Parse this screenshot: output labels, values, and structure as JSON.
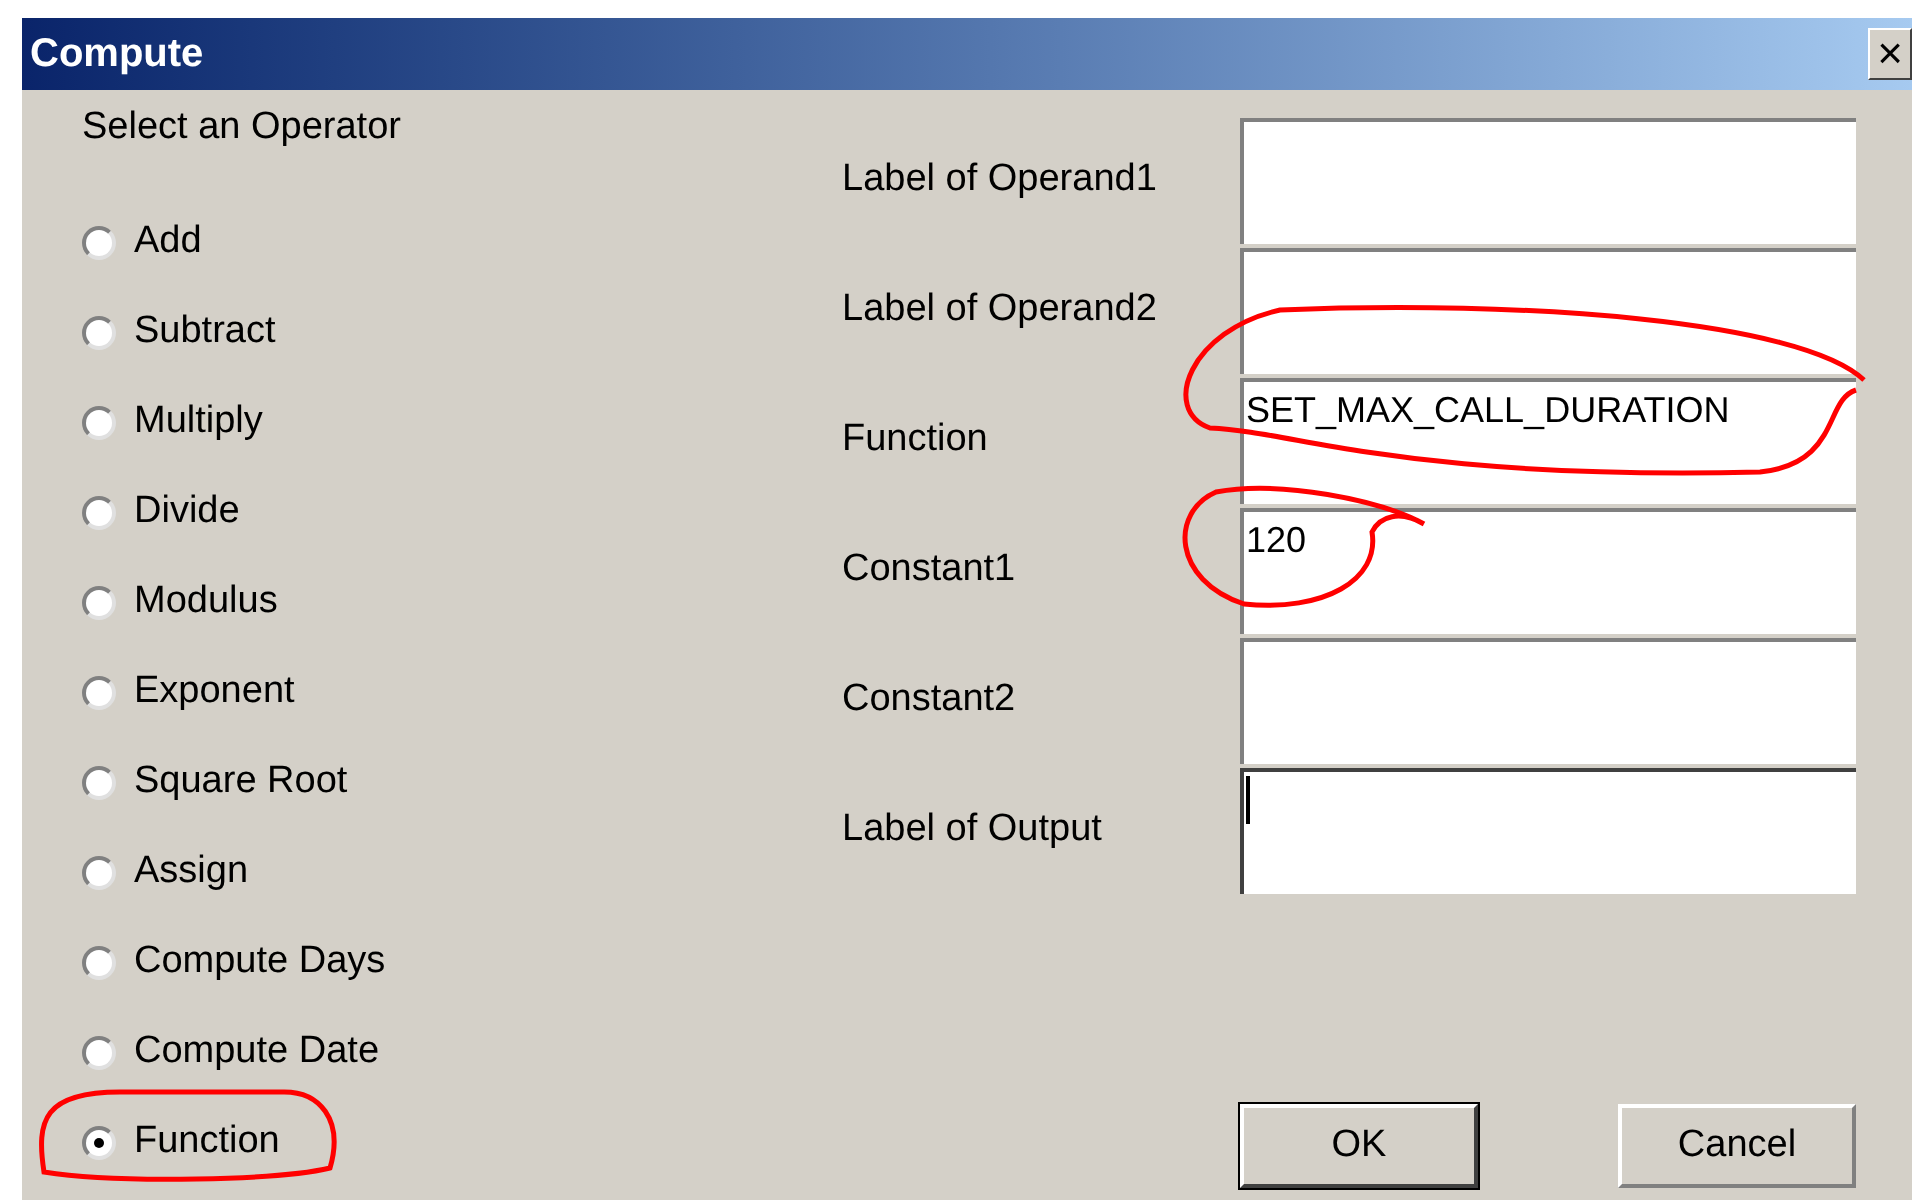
{
  "window": {
    "title": "Compute",
    "close": "×"
  },
  "operator_group": {
    "label": "Select an Operator",
    "options": [
      {
        "label": "Add",
        "selected": false
      },
      {
        "label": "Subtract",
        "selected": false
      },
      {
        "label": "Multiply",
        "selected": false
      },
      {
        "label": "Divide",
        "selected": false
      },
      {
        "label": "Modulus",
        "selected": false
      },
      {
        "label": "Exponent",
        "selected": false
      },
      {
        "label": "Square Root",
        "selected": false
      },
      {
        "label": "Assign",
        "selected": false
      },
      {
        "label": "Compute Days",
        "selected": false
      },
      {
        "label": "Compute Date",
        "selected": false
      },
      {
        "label": "Function",
        "selected": true
      }
    ]
  },
  "fields": [
    {
      "label": "Label of Operand1",
      "focused": false
    },
    {
      "label": "Label of Operand2",
      "focused": false
    },
    {
      "label": "Function",
      "value": "SET_MAX_CALL_DURATION",
      "focused": false
    },
    {
      "label": "Constant1",
      "value": "120",
      "focused": false
    },
    {
      "label": "Constant2",
      "focused": false
    },
    {
      "label": "Label of Output",
      "focused": true
    }
  ],
  "buttons": [
    {
      "label": "OK",
      "default": true
    },
    {
      "label": "Cancel",
      "default": false
    }
  ]
}
